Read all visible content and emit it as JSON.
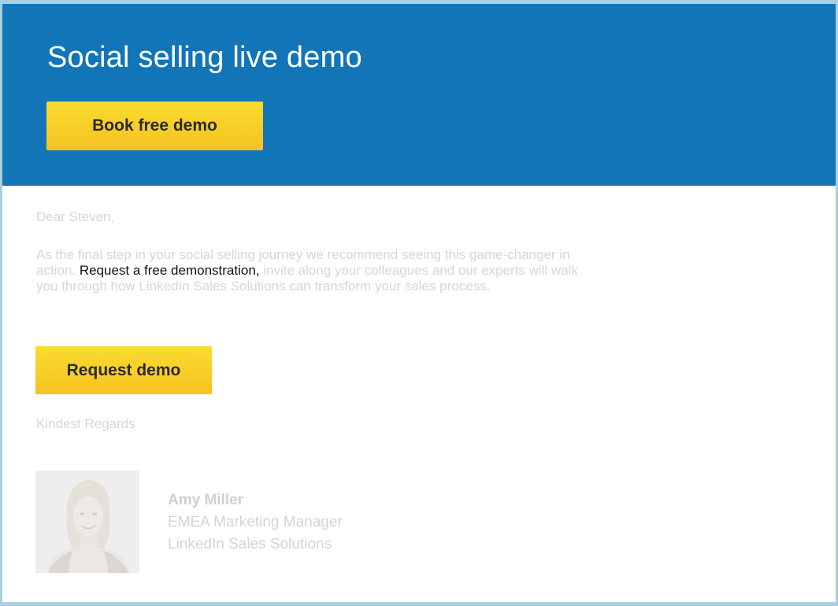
{
  "header": {
    "title": "Social selling live demo",
    "book_button_label": "Book free demo"
  },
  "body": {
    "greeting": "Dear Steven,",
    "paragraph": {
      "line1": "As the final step in your social selling journey we recommend seeing this game-changer in",
      "line2_prefix": "action. ",
      "link_text": "Request a free demonstration,",
      "line2_suffix": " invite along your colleagues and our experts will walk",
      "line3": "you through how LinkedIn Sales Solutions can transform your sales process."
    },
    "request_button_label": "Request demo",
    "regards": "Kindest Regards"
  },
  "signature": {
    "name": "Amy Miller",
    "title": "EMEA Marketing Manager",
    "company": "LinkedIn Sales Solutions"
  },
  "colors": {
    "header_bg": "#1275b8",
    "button_yellow": "#f7c924",
    "muted_text": "#d6d6d6"
  }
}
